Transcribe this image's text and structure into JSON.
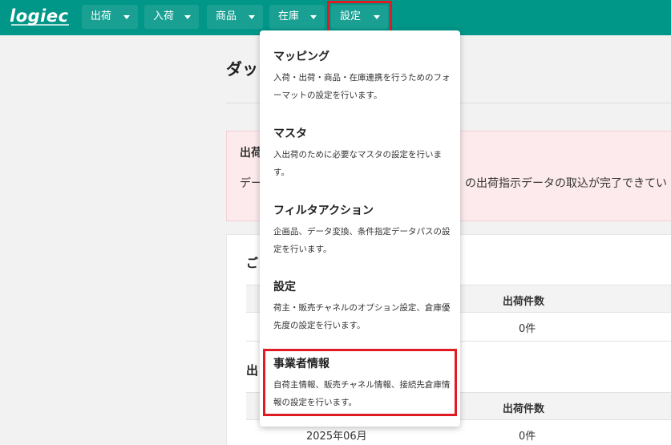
{
  "header": {
    "logo": "logiec",
    "nav": [
      {
        "label": "出荷"
      },
      {
        "label": "入荷"
      },
      {
        "label": "商品"
      },
      {
        "label": "在庫"
      },
      {
        "label": "設定"
      }
    ],
    "accent_color": "#009688"
  },
  "main": {
    "page_title": "ダッ",
    "alert": {
      "title": "出荷",
      "text_left": "デー",
      "text_right": "の出荷指示データの取込が完了できてい",
      "background": "#fdeaec"
    },
    "sections": [
      {
        "title": "ご",
        "column_header": "出荷件数",
        "rows": [
          {
            "month": "",
            "count": "0件"
          }
        ]
      },
      {
        "title": "出",
        "column_header": "出荷件数",
        "rows": [
          {
            "month": "2025年06月",
            "count": "0件"
          }
        ]
      }
    ]
  },
  "settings_menu": {
    "items": [
      {
        "title": "マッピング",
        "description": "入荷・出荷・商品・在庫連携を行うためのフォーマットの設定を行います。"
      },
      {
        "title": "マスタ",
        "description": "入出荷のために必要なマスタの設定を行います。"
      },
      {
        "title": "フィルタアクション",
        "description": "企画品、データ変換、条件指定データパスの設定を行います。"
      },
      {
        "title": "設定",
        "description": "荷主・販売チャネルのオプション設定、倉庫優先度の設定を行います。"
      },
      {
        "title": "事業者情報",
        "description": "自荷主情報、販売チャネル情報、接続先倉庫情報の設定を行います。"
      }
    ]
  },
  "highlight_color": "#e01b24"
}
